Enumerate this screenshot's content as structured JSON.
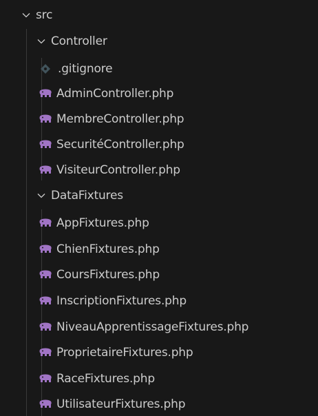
{
  "colors": {
    "background": "#181818",
    "text": "#cccccc",
    "guide": "#3a3a3a",
    "php_icon": "#a074c4",
    "gitignore_icon": "#41535b"
  },
  "tree": {
    "root": {
      "label": "src",
      "expanded": true,
      "icon": "chevron-down-icon"
    },
    "controller_folder": {
      "label": "Controller",
      "expanded": true,
      "icon": "chevron-down-icon",
      "files": [
        {
          "label": ".gitignore",
          "icon": "git-diamond-icon"
        },
        {
          "label": "AdminController.php",
          "icon": "php-elephant-icon"
        },
        {
          "label": "MembreController.php",
          "icon": "php-elephant-icon"
        },
        {
          "label": "SecuritéController.php",
          "icon": "php-elephant-icon"
        },
        {
          "label": "VisiteurController.php",
          "icon": "php-elephant-icon"
        }
      ]
    },
    "datafixtures_folder": {
      "label": "DataFixtures",
      "expanded": true,
      "icon": "chevron-down-icon",
      "files": [
        {
          "label": "AppFixtures.php",
          "icon": "php-elephant-icon"
        },
        {
          "label": "ChienFixtures.php",
          "icon": "php-elephant-icon"
        },
        {
          "label": "CoursFixtures.php",
          "icon": "php-elephant-icon"
        },
        {
          "label": "InscriptionFixtures.php",
          "icon": "php-elephant-icon"
        },
        {
          "label": "NiveauApprentissageFixtures.php",
          "icon": "php-elephant-icon"
        },
        {
          "label": "ProprietaireFixtures.php",
          "icon": "php-elephant-icon"
        },
        {
          "label": "RaceFixtures.php",
          "icon": "php-elephant-icon"
        },
        {
          "label": "UtilisateurFixtures.php",
          "icon": "php-elephant-icon"
        }
      ]
    }
  }
}
